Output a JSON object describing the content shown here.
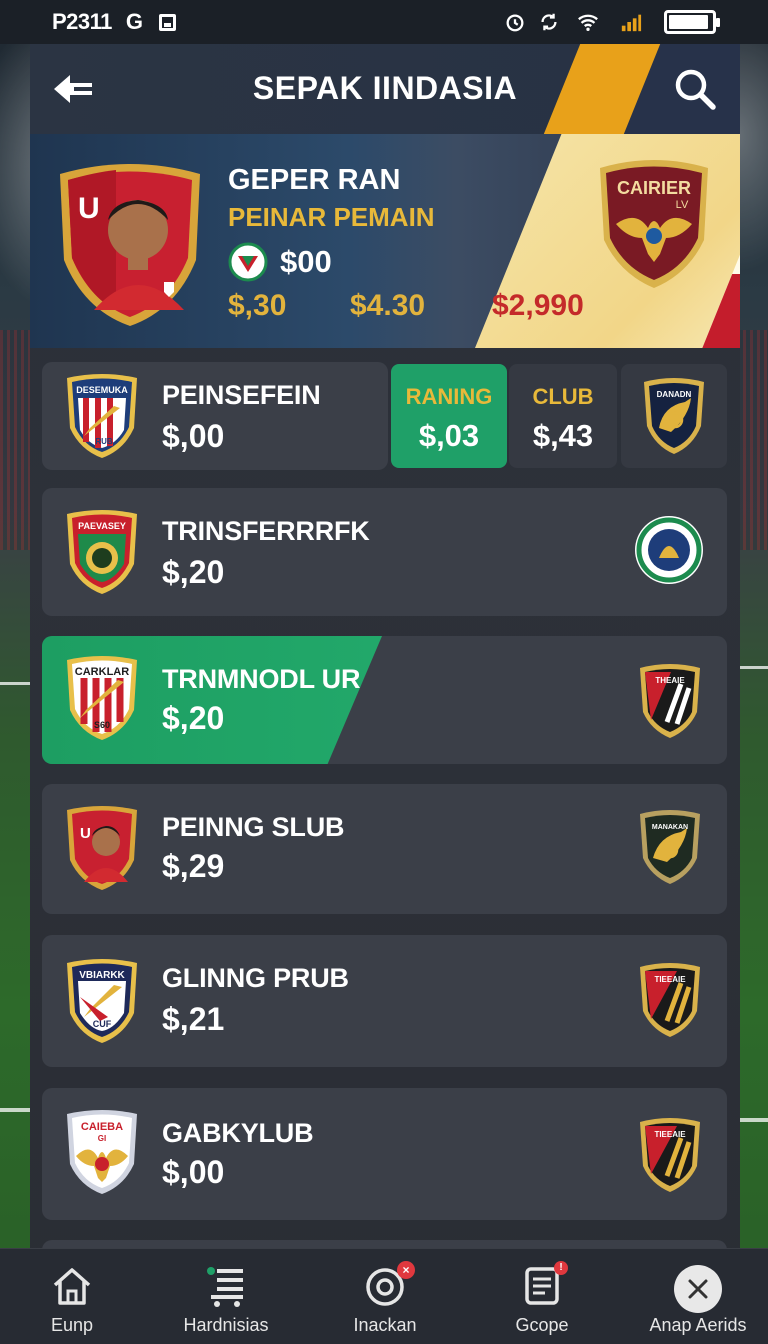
{
  "status_bar": {
    "time": "P2311",
    "carrier_icon": "G",
    "icons": [
      "screenshot-icon",
      "alarm-icon",
      "sync-icon",
      "wifi-icon",
      "battery-icon"
    ],
    "battery_level": 0.85
  },
  "header": {
    "title": "SEPAK IINDASIA",
    "back_icon": "back-arrow-icon",
    "search_icon": "search-icon"
  },
  "hero": {
    "player_name": "GEPER RAN",
    "subtitle": "PEINAR PEMAIN",
    "coin_value": "$00",
    "price_1": "$,30",
    "price_2": "$4.30",
    "price_3": "$2,990",
    "player_badge_text": "U",
    "club_crest_text": "CAIRIER",
    "club_crest_sub": "LV",
    "colors": {
      "gold": "#e2b33d",
      "red": "#c42a2a",
      "accent": "#e8a11a"
    }
  },
  "first_row": {
    "logo_text": "DESEMUKA",
    "logo_sub": "RUB",
    "title": "PEINSEFEIN",
    "price": "$,00",
    "tabs": [
      {
        "label": "RANING",
        "value": "$,03",
        "active": true
      },
      {
        "label": "CLUB",
        "value": "$,43",
        "active": false
      }
    ],
    "side_badge_text": "DANADN"
  },
  "rows": [
    {
      "title": "TRINSFERRRFK",
      "price": "$,20",
      "logo_text": "PAEVASEY",
      "badge_text": "",
      "highlighted": false
    },
    {
      "title": "TRNMNODL UR",
      "price": "$,20",
      "logo_text": "CARKLAR",
      "logo_sub": "S60",
      "badge_text": "THEAIE",
      "highlighted": true
    },
    {
      "title": "PEINNG SLUB",
      "price": "$,29",
      "logo_text": "U",
      "badge_text": "MANAKAN",
      "highlighted": false
    },
    {
      "title": "GLINNG PRUB",
      "price": "$,21",
      "logo_text": "VBIARKK",
      "logo_sub": "CUF",
      "badge_text": "TIEEAIE",
      "highlighted": false
    },
    {
      "title": "GABKYLUB",
      "price": "$,00",
      "logo_text": "CAIEBA",
      "logo_sub": "GI",
      "badge_text": "TIEEAIE",
      "highlighted": false
    }
  ],
  "bottom_nav": [
    {
      "label": "Eunp",
      "icon": "home-icon"
    },
    {
      "label": "Hardnisias",
      "icon": "list-cart-icon"
    },
    {
      "label": "Inackan",
      "icon": "target-icon",
      "badge": "×"
    },
    {
      "label": "Gcope",
      "icon": "document-icon",
      "badge": "!"
    },
    {
      "label": "Anap Aerids",
      "icon": "close-icon"
    }
  ]
}
